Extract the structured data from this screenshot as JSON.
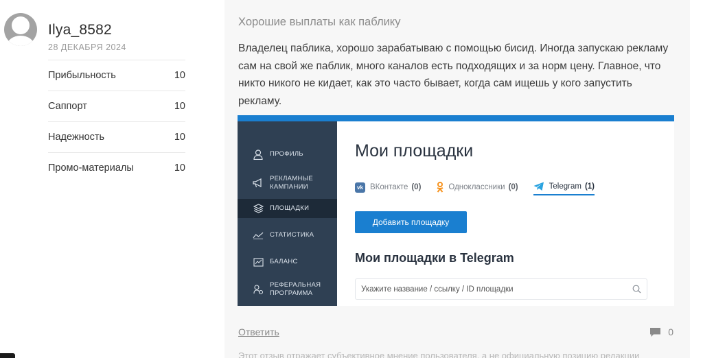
{
  "user": {
    "name": "Ilya_8582",
    "date": "28 ДЕКАБРЯ 2024"
  },
  "ratings": [
    {
      "label": "Прибыльность",
      "value": "10"
    },
    {
      "label": "Саппорт",
      "value": "10"
    },
    {
      "label": "Надежность",
      "value": "10"
    },
    {
      "label": "Промо-материалы",
      "value": "10"
    }
  ],
  "review": {
    "title": "Хорошие выплаты как паблику",
    "text": "Владелец паблика, хорошо зарабатываю с помощью бисид. Иногда запускаю рекламу сам на свой же паблик, много каналов есть подходящих и за норм цену. Главное, что никто никого не кидает, как это часто бывает, когда сам ищешь у кого запустить рекламу."
  },
  "screenshot": {
    "sidebar": [
      {
        "label": "Профиль",
        "icon": "user-icon"
      },
      {
        "label": "Рекламные кампании",
        "icon": "megaphone-icon"
      },
      {
        "label": "Площадки",
        "icon": "layers-icon",
        "active": true
      },
      {
        "label": "Статистика",
        "icon": "chart-line-icon"
      },
      {
        "label": "Баланс",
        "icon": "wallet-icon"
      },
      {
        "label": "Реферальная программа",
        "icon": "referral-icon"
      }
    ],
    "heading": "Мои площадки",
    "tabs": [
      {
        "label": "ВКонтакте",
        "count": "(0)",
        "icon": "vk-icon"
      },
      {
        "label": "Одноклассники",
        "count": "(0)",
        "icon": "ok-icon"
      },
      {
        "label": "Telegram",
        "count": "(1)",
        "icon": "telegram-icon",
        "active": true
      }
    ],
    "add_button": "Добавить площадку",
    "sub_heading": "Мои площадки в Telegram",
    "search_placeholder": "Укажите название / ссылку / ID площадки"
  },
  "footer": {
    "reply": "Ответить",
    "comments_count": "0",
    "disclaimer": "Этот отзыв отражает субъективное мнение пользователя, а не официальную позицию редакции"
  },
  "colors": {
    "accent": "#1a7fd0",
    "sidebar": "#2f4053",
    "sidebar_active": "#1d2a38",
    "card_bg": "#f7f7f7"
  }
}
